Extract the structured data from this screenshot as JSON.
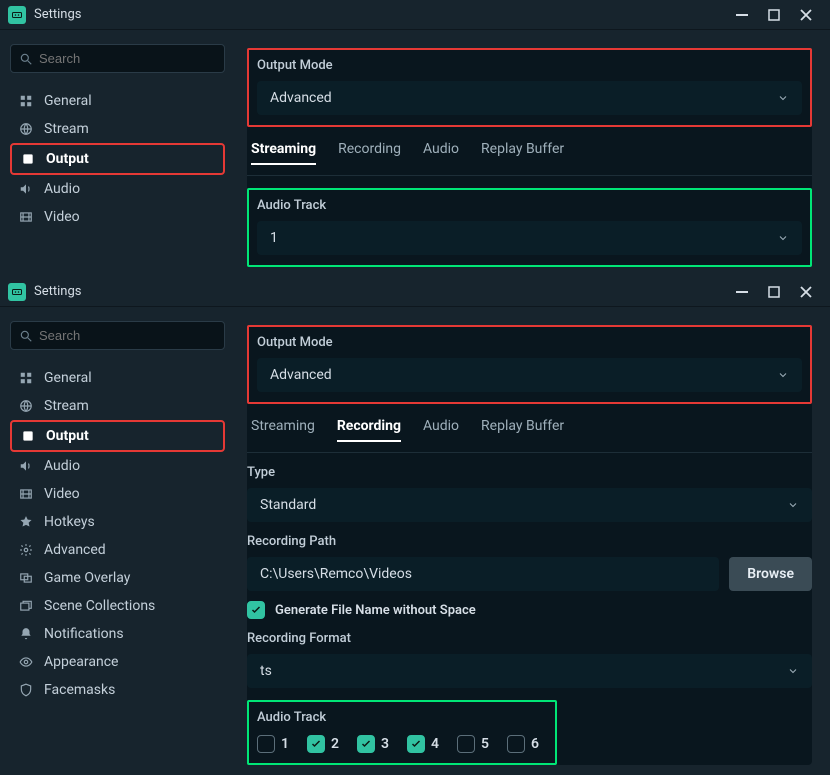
{
  "window_title": "Settings",
  "win1": {
    "search_placeholder": "Search",
    "nav": [
      {
        "label": "General"
      },
      {
        "label": "Stream"
      },
      {
        "label": "Output"
      },
      {
        "label": "Audio"
      },
      {
        "label": "Video"
      }
    ],
    "output_mode_label": "Output Mode",
    "output_mode_value": "Advanced",
    "tabs": [
      "Streaming",
      "Recording",
      "Audio",
      "Replay Buffer"
    ],
    "audio_track_label": "Audio Track",
    "audio_track_value": "1"
  },
  "win2": {
    "search_placeholder": "Search",
    "nav": [
      {
        "label": "General"
      },
      {
        "label": "Stream"
      },
      {
        "label": "Output"
      },
      {
        "label": "Audio"
      },
      {
        "label": "Video"
      },
      {
        "label": "Hotkeys"
      },
      {
        "label": "Advanced"
      },
      {
        "label": "Game Overlay"
      },
      {
        "label": "Scene Collections"
      },
      {
        "label": "Notifications"
      },
      {
        "label": "Appearance"
      },
      {
        "label": "Facemasks"
      }
    ],
    "output_mode_label": "Output Mode",
    "output_mode_value": "Advanced",
    "tabs": [
      "Streaming",
      "Recording",
      "Audio",
      "Replay Buffer"
    ],
    "type_label": "Type",
    "type_value": "Standard",
    "recording_path_label": "Recording Path",
    "recording_path_value": "C:\\Users\\Remco\\Videos",
    "browse_label": "Browse",
    "gen_filename_label": "Generate File Name without Space",
    "recording_format_label": "Recording Format",
    "recording_format_value": "ts",
    "audio_track_label": "Audio Track",
    "audio_tracks": [
      {
        "n": "1",
        "checked": false
      },
      {
        "n": "2",
        "checked": true
      },
      {
        "n": "3",
        "checked": true
      },
      {
        "n": "4",
        "checked": true
      },
      {
        "n": "5",
        "checked": false
      },
      {
        "n": "6",
        "checked": false
      }
    ]
  }
}
